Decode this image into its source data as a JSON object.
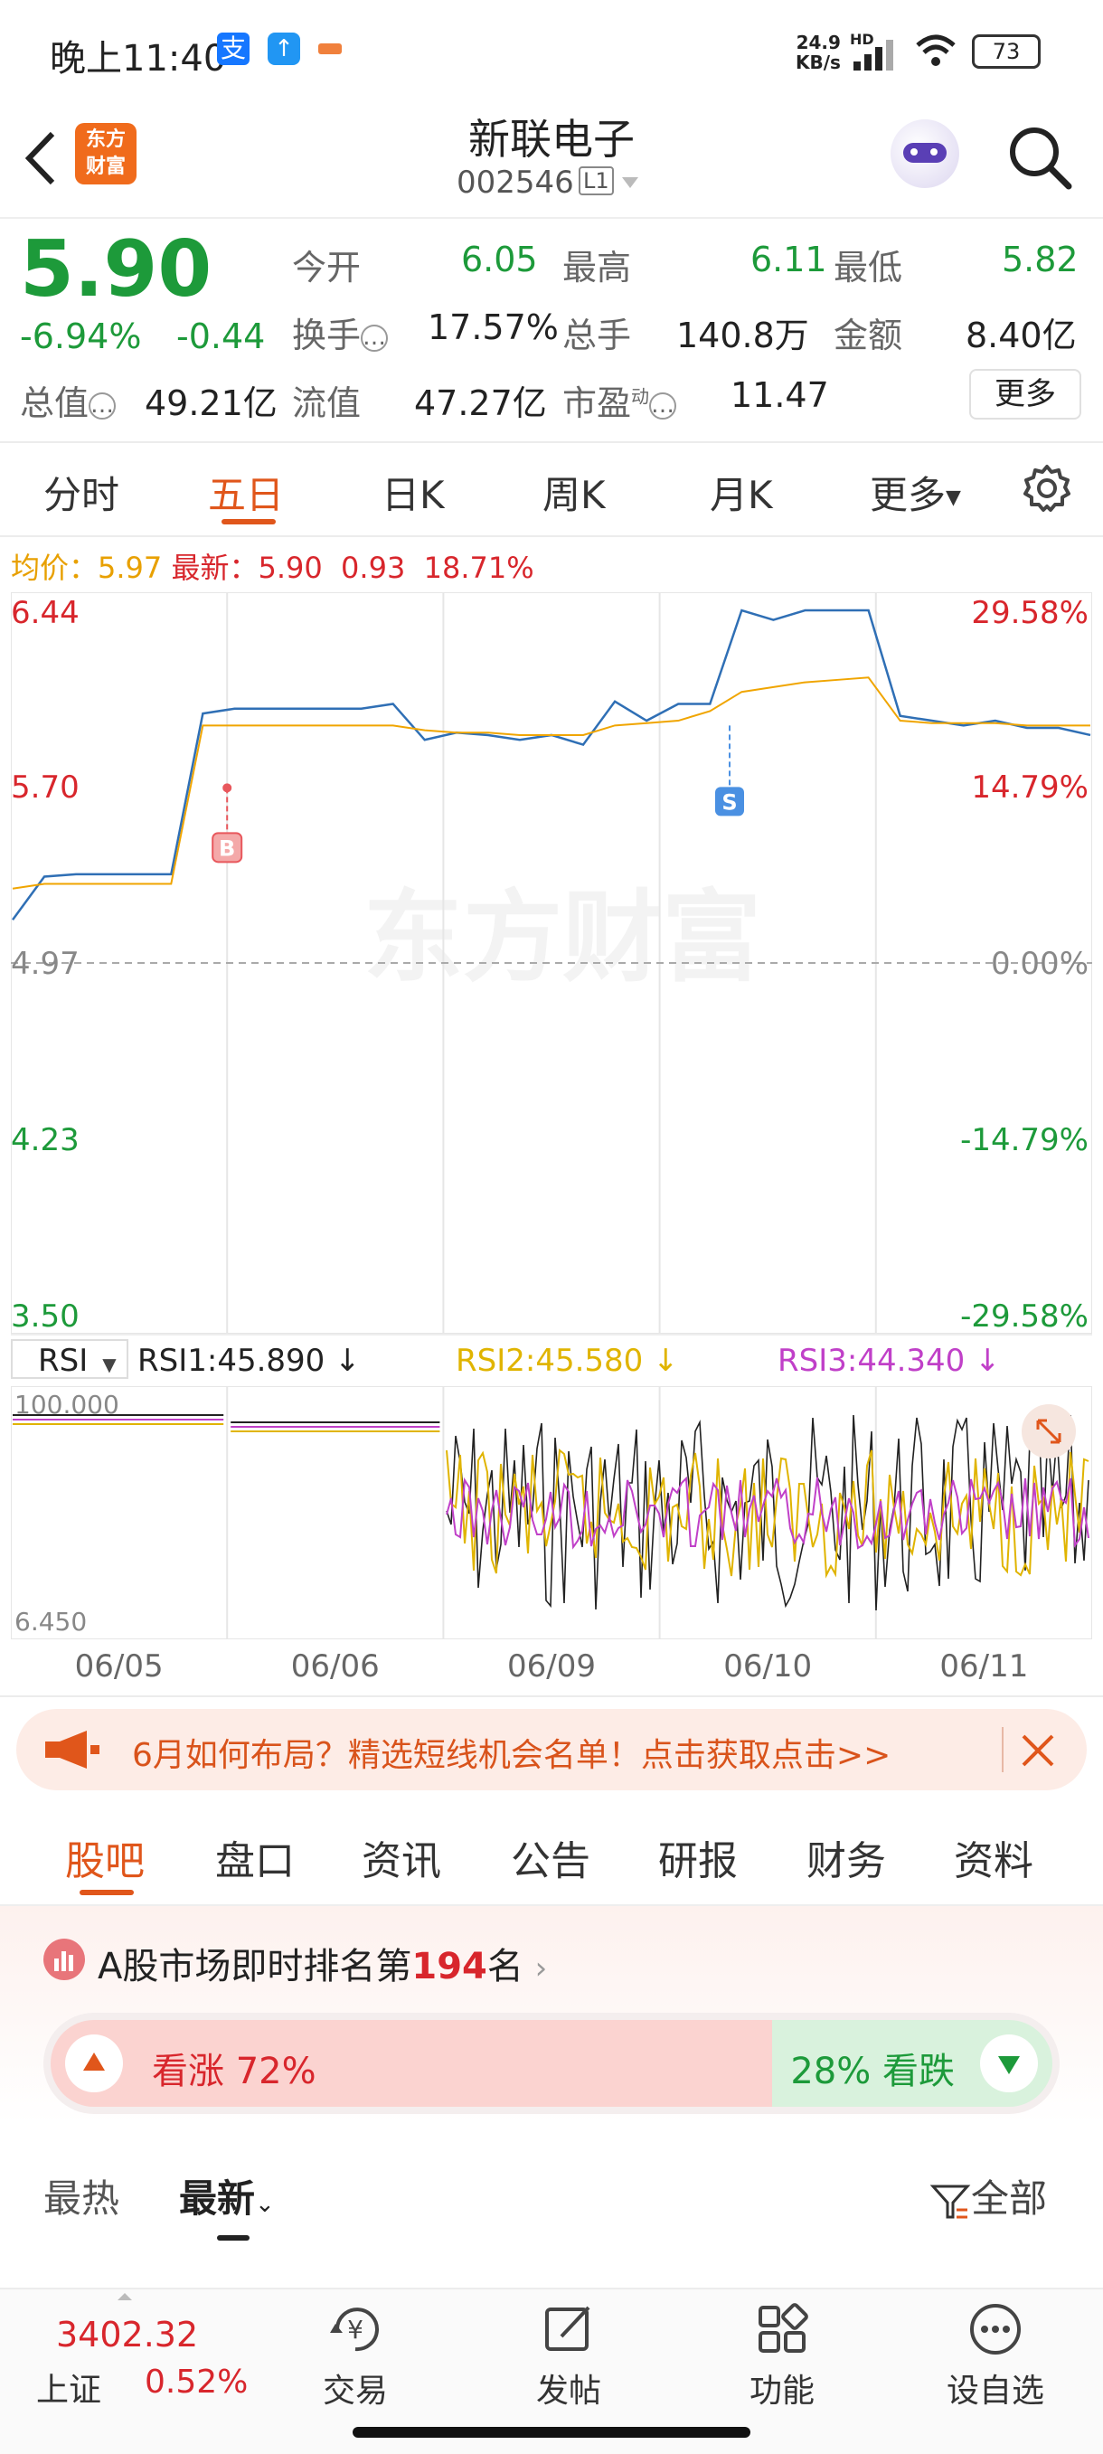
{
  "status_bar": {
    "time": "晚上11:40",
    "net_speed_top": "24.9",
    "net_speed_unit": "KB/s",
    "hd": "HD",
    "battery": "73"
  },
  "header": {
    "stock_name": "新联电子",
    "stock_code": "002546",
    "level": "L1",
    "logo_line1": "东方",
    "logo_line2": "财富"
  },
  "quote": {
    "price": "5.90",
    "change_pct": "-6.94%",
    "change": "-0.44",
    "open_label": "今开",
    "open": "6.05",
    "high_label": "最高",
    "high": "6.11",
    "low_label": "最低",
    "low": "5.82",
    "turnover_label": "换手",
    "turnover": "17.57%",
    "volume_label": "总手",
    "volume": "140.8万",
    "amount_label": "金额",
    "amount": "8.40亿",
    "total_cap_label": "总值",
    "total_cap": "49.21亿",
    "float_cap_label": "流值",
    "float_cap": "47.27亿",
    "pe_label": "市盈",
    "pe_sup": "动",
    "pe": "11.47",
    "more_button": "更多"
  },
  "chart_tabs": [
    "分时",
    "五日",
    "日K",
    "周K",
    "月K",
    "更多"
  ],
  "chart_tab_active": 1,
  "price_info": {
    "avg_label": "均价：",
    "avg": "5.97",
    "latest_label": "最新：",
    "latest": "5.90",
    "change": "0.93",
    "change_pct": "18.71%"
  },
  "watermark": "东方财富",
  "markers": {
    "buy": "B",
    "sell": "S"
  },
  "chart_data": [
    {
      "type": "line",
      "y_left_ticks": [
        "6.44",
        "5.70",
        "4.97",
        "4.23",
        "3.50"
      ],
      "y_right_ticks": [
        "29.58%",
        "14.79%",
        "0.00%",
        "-14.79%",
        "-29.58%"
      ],
      "ylim": [
        3.5,
        6.44
      ],
      "x_dates": [
        "06/05",
        "06/06",
        "06/09",
        "06/10",
        "06/11"
      ],
      "series": [
        {
          "name": "最新",
          "color": "#2f6fb5",
          "values": [
            5.15,
            5.33,
            5.34,
            5.34,
            5.34,
            5.34,
            6.01,
            6.03,
            6.03,
            6.03,
            6.03,
            6.03,
            6.05,
            5.9,
            5.93,
            5.92,
            5.9,
            5.92,
            5.88,
            6.06,
            5.98,
            6.05,
            6.05,
            6.44,
            6.4,
            6.44,
            6.44,
            6.44,
            6.0,
            5.98,
            5.96,
            5.98,
            5.95,
            5.95,
            5.92
          ]
        },
        {
          "name": "均价",
          "color": "#f0a500",
          "values": [
            5.28,
            5.3,
            5.3,
            5.3,
            5.3,
            5.3,
            5.96,
            5.96,
            5.96,
            5.96,
            5.96,
            5.96,
            5.96,
            5.94,
            5.93,
            5.93,
            5.92,
            5.92,
            5.92,
            5.96,
            5.97,
            5.98,
            6.02,
            6.1,
            6.12,
            6.14,
            6.15,
            6.16,
            5.98,
            5.97,
            5.97,
            5.97,
            5.96,
            5.96,
            5.96
          ]
        }
      ]
    },
    {
      "type": "line",
      "indicator": "RSI",
      "top_label": "100.000",
      "bottom_label": "6.450",
      "ylim": [
        6.45,
        100
      ],
      "series": [
        {
          "name": "RSI1",
          "value_text": "RSI1:45.890",
          "color": "#222222"
        },
        {
          "name": "RSI2",
          "value_text": "RSI2:45.580",
          "color": "#e0b400"
        },
        {
          "name": "RSI3",
          "value_text": "RSI3:44.340",
          "color": "#c040c8"
        }
      ]
    }
  ],
  "ad_banner": {
    "text": "6月如何布局？精选短线机会名单！点击获取点击>>"
  },
  "sub_tabs": [
    "股吧",
    "盘口",
    "资讯",
    "公告",
    "研报",
    "财务",
    "资料"
  ],
  "sub_tab_active": 0,
  "ranking": {
    "prefix": "A股市场即时排名第",
    "rank": "194",
    "suffix": "名"
  },
  "sentiment": {
    "up_label": "看涨 72%",
    "down_label": "28% 看跌",
    "up_pct": 72
  },
  "feed_tabs": {
    "hot": "最热",
    "latest": "最新",
    "filter": "全部"
  },
  "bottom_bar": {
    "index_value": "3402.32",
    "index_name": "上证",
    "index_change": "0.52%",
    "items": [
      "交易",
      "发帖",
      "功能",
      "设自选"
    ]
  }
}
